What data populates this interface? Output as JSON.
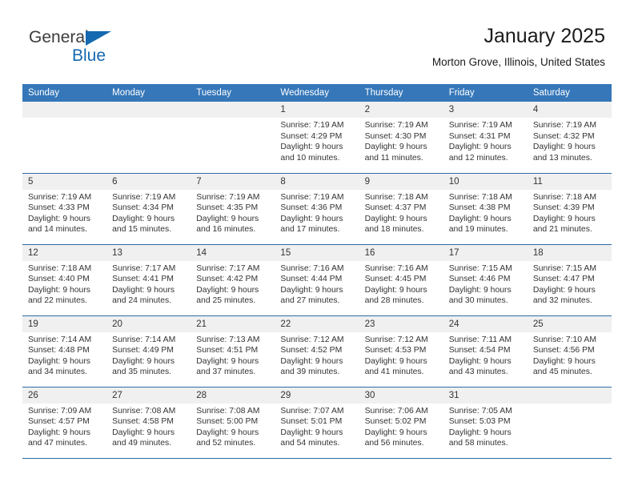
{
  "brand": {
    "name_top": "General",
    "name_bottom": "Blue",
    "triangle_icon": "blue-triangle-icon",
    "accent_color": "#1569b0",
    "text_color": "#3c3c3c"
  },
  "header": {
    "title": "January 2025",
    "subtitle": "Morton Grove, Illinois, United States"
  },
  "calendar": {
    "header_background": "#3577b9",
    "header_text_color": "#ffffff",
    "daynum_background": "#f0f0f0",
    "weekday_headers": [
      "Sunday",
      "Monday",
      "Tuesday",
      "Wednesday",
      "Thursday",
      "Friday",
      "Saturday"
    ],
    "weeks": [
      [
        {
          "day": "",
          "lines": []
        },
        {
          "day": "",
          "lines": []
        },
        {
          "day": "",
          "lines": []
        },
        {
          "day": "1",
          "lines": [
            "Sunrise: 7:19 AM",
            "Sunset: 4:29 PM",
            "Daylight: 9 hours",
            "and 10 minutes."
          ]
        },
        {
          "day": "2",
          "lines": [
            "Sunrise: 7:19 AM",
            "Sunset: 4:30 PM",
            "Daylight: 9 hours",
            "and 11 minutes."
          ]
        },
        {
          "day": "3",
          "lines": [
            "Sunrise: 7:19 AM",
            "Sunset: 4:31 PM",
            "Daylight: 9 hours",
            "and 12 minutes."
          ]
        },
        {
          "day": "4",
          "lines": [
            "Sunrise: 7:19 AM",
            "Sunset: 4:32 PM",
            "Daylight: 9 hours",
            "and 13 minutes."
          ]
        }
      ],
      [
        {
          "day": "5",
          "lines": [
            "Sunrise: 7:19 AM",
            "Sunset: 4:33 PM",
            "Daylight: 9 hours",
            "and 14 minutes."
          ]
        },
        {
          "day": "6",
          "lines": [
            "Sunrise: 7:19 AM",
            "Sunset: 4:34 PM",
            "Daylight: 9 hours",
            "and 15 minutes."
          ]
        },
        {
          "day": "7",
          "lines": [
            "Sunrise: 7:19 AM",
            "Sunset: 4:35 PM",
            "Daylight: 9 hours",
            "and 16 minutes."
          ]
        },
        {
          "day": "8",
          "lines": [
            "Sunrise: 7:19 AM",
            "Sunset: 4:36 PM",
            "Daylight: 9 hours",
            "and 17 minutes."
          ]
        },
        {
          "day": "9",
          "lines": [
            "Sunrise: 7:18 AM",
            "Sunset: 4:37 PM",
            "Daylight: 9 hours",
            "and 18 minutes."
          ]
        },
        {
          "day": "10",
          "lines": [
            "Sunrise: 7:18 AM",
            "Sunset: 4:38 PM",
            "Daylight: 9 hours",
            "and 19 minutes."
          ]
        },
        {
          "day": "11",
          "lines": [
            "Sunrise: 7:18 AM",
            "Sunset: 4:39 PM",
            "Daylight: 9 hours",
            "and 21 minutes."
          ]
        }
      ],
      [
        {
          "day": "12",
          "lines": [
            "Sunrise: 7:18 AM",
            "Sunset: 4:40 PM",
            "Daylight: 9 hours",
            "and 22 minutes."
          ]
        },
        {
          "day": "13",
          "lines": [
            "Sunrise: 7:17 AM",
            "Sunset: 4:41 PM",
            "Daylight: 9 hours",
            "and 24 minutes."
          ]
        },
        {
          "day": "14",
          "lines": [
            "Sunrise: 7:17 AM",
            "Sunset: 4:42 PM",
            "Daylight: 9 hours",
            "and 25 minutes."
          ]
        },
        {
          "day": "15",
          "lines": [
            "Sunrise: 7:16 AM",
            "Sunset: 4:44 PM",
            "Daylight: 9 hours",
            "and 27 minutes."
          ]
        },
        {
          "day": "16",
          "lines": [
            "Sunrise: 7:16 AM",
            "Sunset: 4:45 PM",
            "Daylight: 9 hours",
            "and 28 minutes."
          ]
        },
        {
          "day": "17",
          "lines": [
            "Sunrise: 7:15 AM",
            "Sunset: 4:46 PM",
            "Daylight: 9 hours",
            "and 30 minutes."
          ]
        },
        {
          "day": "18",
          "lines": [
            "Sunrise: 7:15 AM",
            "Sunset: 4:47 PM",
            "Daylight: 9 hours",
            "and 32 minutes."
          ]
        }
      ],
      [
        {
          "day": "19",
          "lines": [
            "Sunrise: 7:14 AM",
            "Sunset: 4:48 PM",
            "Daylight: 9 hours",
            "and 34 minutes."
          ]
        },
        {
          "day": "20",
          "lines": [
            "Sunrise: 7:14 AM",
            "Sunset: 4:49 PM",
            "Daylight: 9 hours",
            "and 35 minutes."
          ]
        },
        {
          "day": "21",
          "lines": [
            "Sunrise: 7:13 AM",
            "Sunset: 4:51 PM",
            "Daylight: 9 hours",
            "and 37 minutes."
          ]
        },
        {
          "day": "22",
          "lines": [
            "Sunrise: 7:12 AM",
            "Sunset: 4:52 PM",
            "Daylight: 9 hours",
            "and 39 minutes."
          ]
        },
        {
          "day": "23",
          "lines": [
            "Sunrise: 7:12 AM",
            "Sunset: 4:53 PM",
            "Daylight: 9 hours",
            "and 41 minutes."
          ]
        },
        {
          "day": "24",
          "lines": [
            "Sunrise: 7:11 AM",
            "Sunset: 4:54 PM",
            "Daylight: 9 hours",
            "and 43 minutes."
          ]
        },
        {
          "day": "25",
          "lines": [
            "Sunrise: 7:10 AM",
            "Sunset: 4:56 PM",
            "Daylight: 9 hours",
            "and 45 minutes."
          ]
        }
      ],
      [
        {
          "day": "26",
          "lines": [
            "Sunrise: 7:09 AM",
            "Sunset: 4:57 PM",
            "Daylight: 9 hours",
            "and 47 minutes."
          ]
        },
        {
          "day": "27",
          "lines": [
            "Sunrise: 7:08 AM",
            "Sunset: 4:58 PM",
            "Daylight: 9 hours",
            "and 49 minutes."
          ]
        },
        {
          "day": "28",
          "lines": [
            "Sunrise: 7:08 AM",
            "Sunset: 5:00 PM",
            "Daylight: 9 hours",
            "and 52 minutes."
          ]
        },
        {
          "day": "29",
          "lines": [
            "Sunrise: 7:07 AM",
            "Sunset: 5:01 PM",
            "Daylight: 9 hours",
            "and 54 minutes."
          ]
        },
        {
          "day": "30",
          "lines": [
            "Sunrise: 7:06 AM",
            "Sunset: 5:02 PM",
            "Daylight: 9 hours",
            "and 56 minutes."
          ]
        },
        {
          "day": "31",
          "lines": [
            "Sunrise: 7:05 AM",
            "Sunset: 5:03 PM",
            "Daylight: 9 hours",
            "and 58 minutes."
          ]
        },
        {
          "day": "",
          "lines": []
        }
      ]
    ]
  }
}
